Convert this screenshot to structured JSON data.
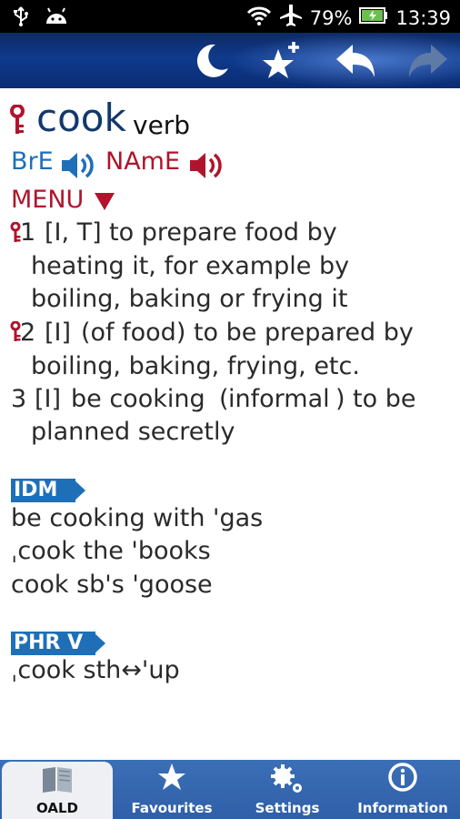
{
  "status": {
    "battery": "79%",
    "time": "13:39"
  },
  "entry": {
    "headword": "cook",
    "pos": "verb",
    "bre": "BrE",
    "name": "NAmE",
    "menu": "MENU",
    "senses": [
      {
        "num": "1",
        "grammar": "[I, T]",
        "line1": "to prepare food by",
        "line2": "heating it, for example by",
        "line3": "boiling, baking or frying it"
      },
      {
        "num": "2",
        "grammar": "[I]",
        "line1": "(of food) to be prepared by",
        "line2": "boiling, baking, frying, etc."
      },
      {
        "num": "3",
        "grammar": "[I]",
        "phrase": "be cooking",
        "paren_open": "(",
        "register": "informal",
        "paren_close": ")",
        "rest": "to be",
        "line2": "planned secretly"
      }
    ]
  },
  "idioms": {
    "tag": "IDM",
    "items": [
      "be cooking with 'gas",
      "ˌcook the 'books",
      "cook sb's 'goose"
    ]
  },
  "phrasal": {
    "tag": "PHR V",
    "items": [
      "ˌcook sth↔'up"
    ]
  },
  "nav": {
    "items": [
      {
        "label": "OALD",
        "icon": "book-icon"
      },
      {
        "label": "Favourites",
        "icon": "star-icon"
      },
      {
        "label": "Settings",
        "icon": "gear-icon"
      },
      {
        "label": "Information",
        "icon": "info-icon"
      }
    ]
  }
}
